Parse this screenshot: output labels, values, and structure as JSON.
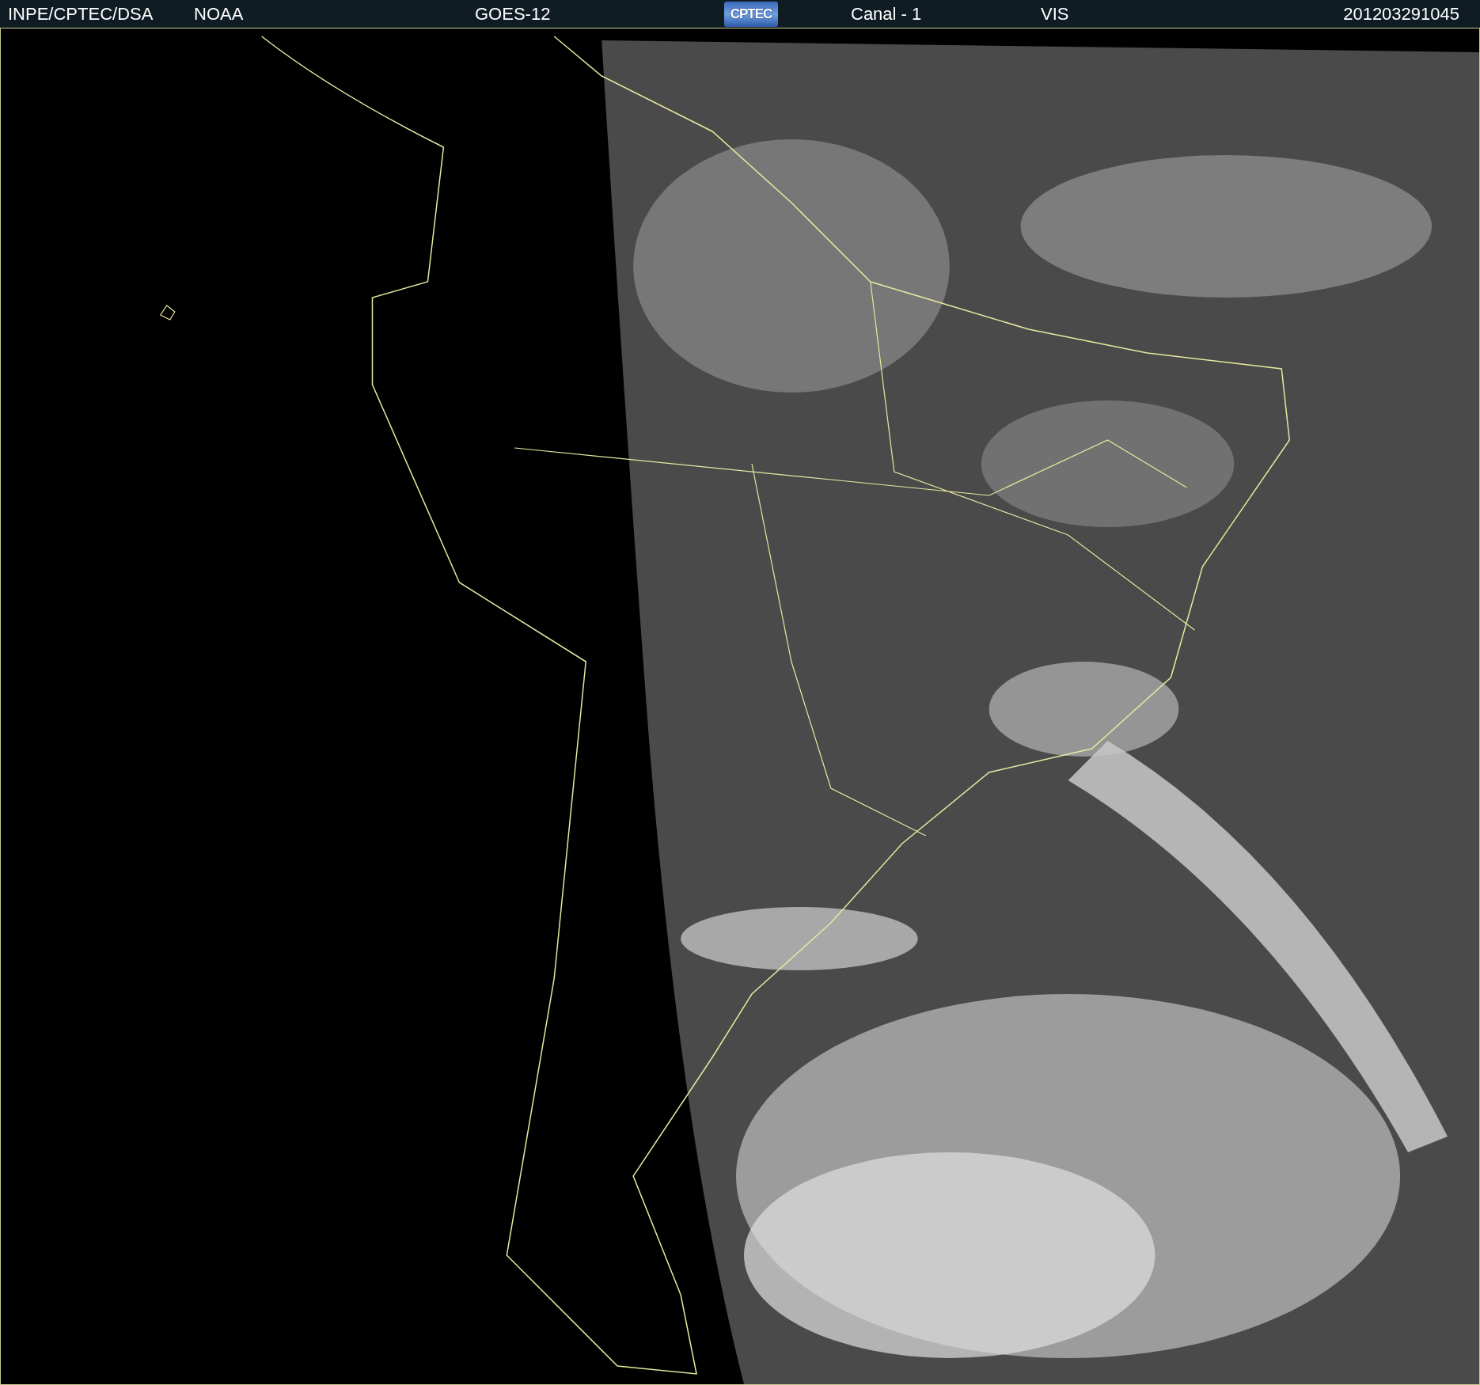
{
  "header": {
    "source": "INPE/CPTEC/DSA",
    "agency": "NOAA",
    "satellite": "GOES-12",
    "logo": "CPTEC",
    "channel": "Canal - 1",
    "band": "VIS",
    "timestamp": "201203291045"
  }
}
